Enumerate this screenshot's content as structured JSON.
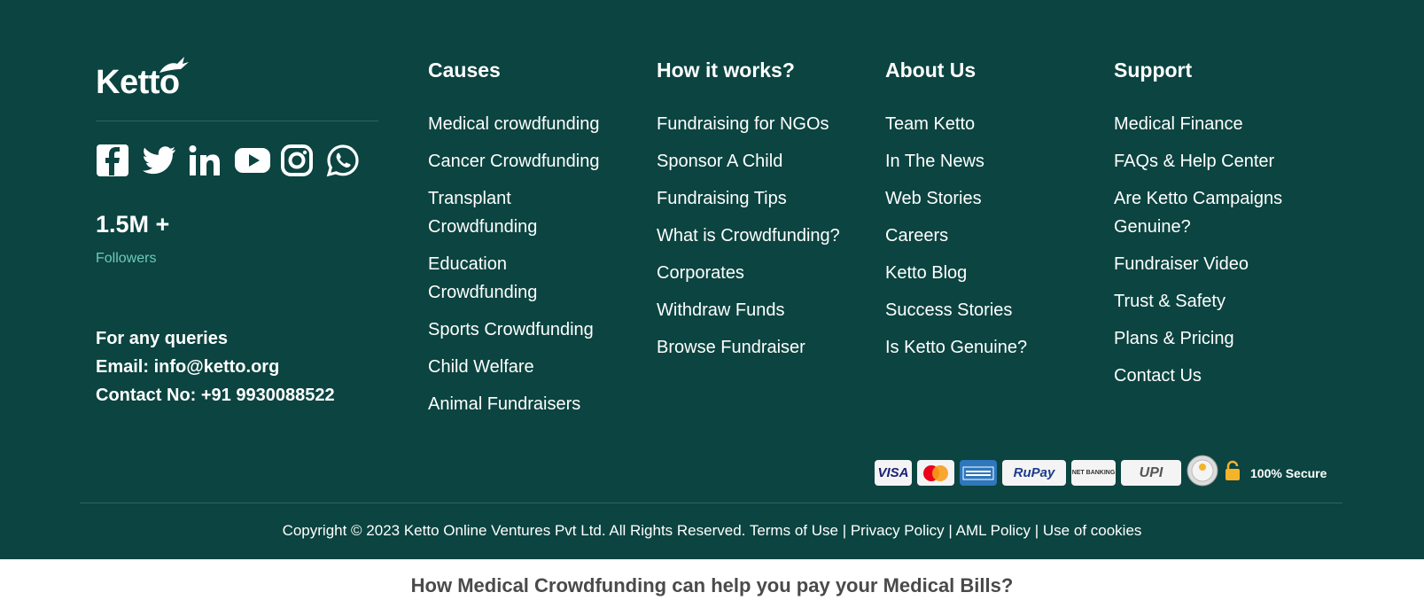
{
  "brand": {
    "name": "Ketto"
  },
  "social": {
    "icons": [
      "facebook-icon",
      "twitter-icon",
      "linkedin-icon",
      "youtube-icon",
      "instagram-icon",
      "whatsapp-icon"
    ],
    "followers_count": "1.5M +",
    "followers_label": "Followers"
  },
  "contact": {
    "heading": "For any queries",
    "email": "Email: info@ketto.org",
    "phone": "Contact No: +91 9930088522"
  },
  "columns": [
    {
      "title": "Causes",
      "links": [
        "Medical crowdfunding",
        "Cancer Crowdfunding",
        "Transplant Crowdfunding",
        "Education Crowdfunding",
        "Sports Crowdfunding",
        "Child Welfare",
        "Animal Fundraisers"
      ]
    },
    {
      "title": "How it works?",
      "links": [
        "Fundraising for NGOs",
        "Sponsor A Child",
        "Fundraising Tips",
        "What is Crowdfunding?",
        "Corporates",
        "Withdraw Funds",
        "Browse Fundraiser"
      ]
    },
    {
      "title": "About Us",
      "links": [
        "Team Ketto",
        "In The News",
        "Web Stories",
        "Careers",
        "Ketto Blog",
        "Success Stories",
        "Is Ketto Genuine?"
      ]
    },
    {
      "title": "Support",
      "links": [
        "Medical Finance",
        "FAQs & Help Center",
        "Are Ketto Campaigns Genuine?",
        "Fundraiser Video",
        "Trust & Safety",
        "Plans & Pricing",
        "Contact Us"
      ]
    }
  ],
  "payments": {
    "methods": [
      "VISA",
      "RuPay",
      "NET BANKING",
      "UPI"
    ],
    "secure_label": "100% Secure"
  },
  "legal": {
    "copyright": "Copyright © 2023 Ketto Online Ventures Pvt Ltd. All Rights Reserved.",
    "links": [
      "Terms of Use",
      "Privacy Policy",
      "AML Policy",
      "Use of cookies"
    ],
    "separator": "|"
  },
  "next_section": {
    "title": "How Medical Crowdfunding can help you pay your Medical Bills?"
  },
  "colors": {
    "footer_bg": "#0b4440",
    "accent": "#6fc8bd"
  }
}
